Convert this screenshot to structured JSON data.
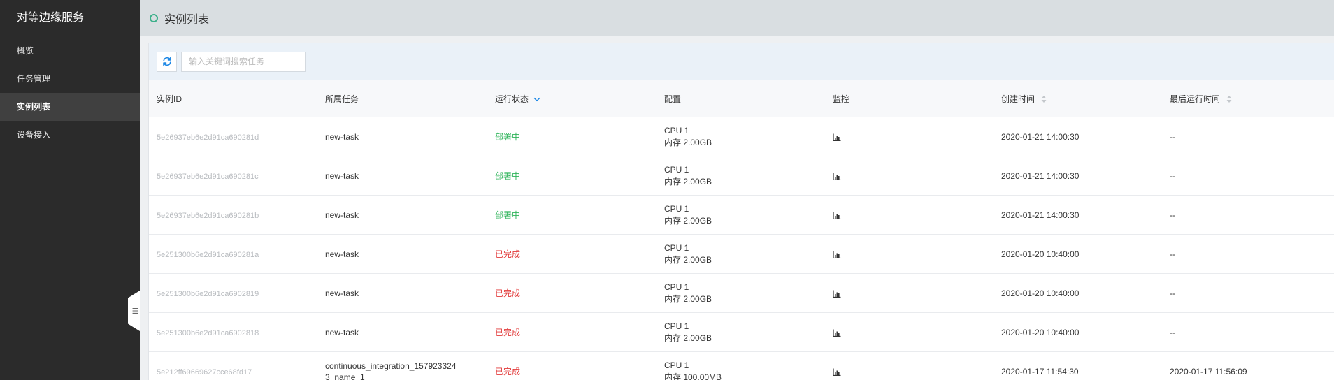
{
  "sidebar": {
    "title": "对等边缘服务",
    "items": [
      {
        "label": "概览",
        "active": false
      },
      {
        "label": "任务管理",
        "active": false
      },
      {
        "label": "实例列表",
        "active": true
      },
      {
        "label": "设备接入",
        "active": false
      }
    ],
    "collapse_icon": "collapse-menu-icon"
  },
  "header": {
    "title": "实例列表",
    "accent_color": "#3cb08a"
  },
  "toolbar": {
    "refresh_icon": "refresh-icon",
    "search_placeholder": "输入关键词搜索任务"
  },
  "table": {
    "columns": {
      "id": "实例ID",
      "task": "所属任务",
      "status": "运行状态",
      "config": "配置",
      "monitor": "监控",
      "created": "创建时间",
      "last_run": "最后运行时间"
    },
    "status_colors": {
      "部署中": "#2fb45a",
      "已完成": "#e23a3a"
    },
    "rows": [
      {
        "id": "5e26937eb6e2d91ca690281d",
        "task": "new-task",
        "status": "部署中",
        "cpu": "CPU 1",
        "mem": "内存 2.00GB",
        "created": "2020-01-21 14:00:30",
        "last_run": "--"
      },
      {
        "id": "5e26937eb6e2d91ca690281c",
        "task": "new-task",
        "status": "部署中",
        "cpu": "CPU 1",
        "mem": "内存 2.00GB",
        "created": "2020-01-21 14:00:30",
        "last_run": "--"
      },
      {
        "id": "5e26937eb6e2d91ca690281b",
        "task": "new-task",
        "status": "部署中",
        "cpu": "CPU 1",
        "mem": "内存 2.00GB",
        "created": "2020-01-21 14:00:30",
        "last_run": "--"
      },
      {
        "id": "5e251300b6e2d91ca690281a",
        "task": "new-task",
        "status": "已完成",
        "cpu": "CPU 1",
        "mem": "内存 2.00GB",
        "created": "2020-01-20 10:40:00",
        "last_run": "--"
      },
      {
        "id": "5e251300b6e2d91ca6902819",
        "task": "new-task",
        "status": "已完成",
        "cpu": "CPU 1",
        "mem": "内存 2.00GB",
        "created": "2020-01-20 10:40:00",
        "last_run": "--"
      },
      {
        "id": "5e251300b6e2d91ca6902818",
        "task": "new-task",
        "status": "已完成",
        "cpu": "CPU 1",
        "mem": "内存 2.00GB",
        "created": "2020-01-20 10:40:00",
        "last_run": "--"
      },
      {
        "id": "5e212ff69669627cce68fd17",
        "task": "continuous_integration_1579233243_name_1",
        "status": "已完成",
        "cpu": "CPU 1",
        "mem": "内存 100.00MB",
        "created": "2020-01-17 11:54:30",
        "last_run": "2020-01-17 11:56:09"
      }
    ]
  }
}
